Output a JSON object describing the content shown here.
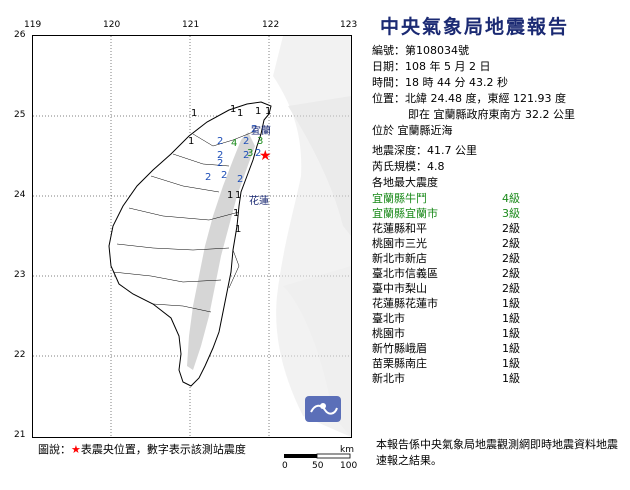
{
  "map": {
    "lon_ticks": [
      "119",
      "120",
      "121",
      "122",
      "123"
    ],
    "lat_ticks": [
      "26",
      "25",
      "24",
      "23",
      "22",
      "21"
    ],
    "scale_unit": "km",
    "scale_ticks": [
      "0",
      "50",
      "100"
    ],
    "station_labels": [
      "1",
      "1",
      "1",
      "1",
      "1",
      "1",
      "2",
      "2",
      "2",
      "2",
      "2",
      "2",
      "2",
      "3",
      "3",
      "4",
      "2",
      "2",
      "2",
      "1",
      "1",
      "1",
      "1"
    ],
    "place_labels": [
      "宜蘭",
      "花蓮"
    ],
    "colors": {
      "land": "#ffffff",
      "mountain": "#d7d7d7",
      "epicenter": "#ff0000",
      "level1": "#000000",
      "level2": "#1f4fb7",
      "level3": "#1f4fb7",
      "level4": "#1a8a1a"
    }
  },
  "report": {
    "title": "中央氣象局地震報告",
    "number_label": "編號：",
    "number_value": "第108034號",
    "date_label": "日期：",
    "date_value": "108 年 5 月 2 日",
    "time_label": "時間：",
    "time_value": "18 時 44 分 43.2 秒",
    "location_label": "位置：",
    "location_value": "北緯 24.48 度，東經 121.93 度",
    "location_line2": "即在 宜蘭縣政府東南方 32.2 公里",
    "location_line3": "位於 宜蘭縣近海",
    "depth_label": "地震深度：",
    "depth_value": "41.7 公里",
    "magnitude_label": "芮氏規模：",
    "magnitude_value": "4.8",
    "intensity_header": "各地最大震度"
  },
  "intensities": [
    {
      "place": "宜蘭縣牛鬥",
      "level": "4級",
      "color": "#1a8a1a"
    },
    {
      "place": "宜蘭縣宜蘭市",
      "level": "3級",
      "color": "#1a8a1a"
    },
    {
      "place": "花蓮縣和平",
      "level": "2級",
      "color": "#000000"
    },
    {
      "place": "桃園市三光",
      "level": "2級",
      "color": "#000000"
    },
    {
      "place": "新北市新店",
      "level": "2級",
      "color": "#000000"
    },
    {
      "place": "臺北市信義區",
      "level": "2級",
      "color": "#000000"
    },
    {
      "place": "臺中市梨山",
      "level": "2級",
      "color": "#000000"
    },
    {
      "place": "花蓮縣花蓮市",
      "level": "1級",
      "color": "#000000"
    },
    {
      "place": "臺北市",
      "level": "1級",
      "color": "#000000"
    },
    {
      "place": "桃園市",
      "level": "1級",
      "color": "#000000"
    },
    {
      "place": "新竹縣峨眉",
      "level": "1級",
      "color": "#000000"
    },
    {
      "place": "苗栗縣南庄",
      "level": "1級",
      "color": "#000000"
    },
    {
      "place": "新北市",
      "level": "1級",
      "color": "#000000"
    }
  ],
  "legend": {
    "prefix": "圖說：",
    "star": "★",
    "text": "表震央位置，數字表示該測站震度"
  },
  "footnote": "本報告係中央氣象局地震觀測網即時地震資料地震速報之結果。"
}
